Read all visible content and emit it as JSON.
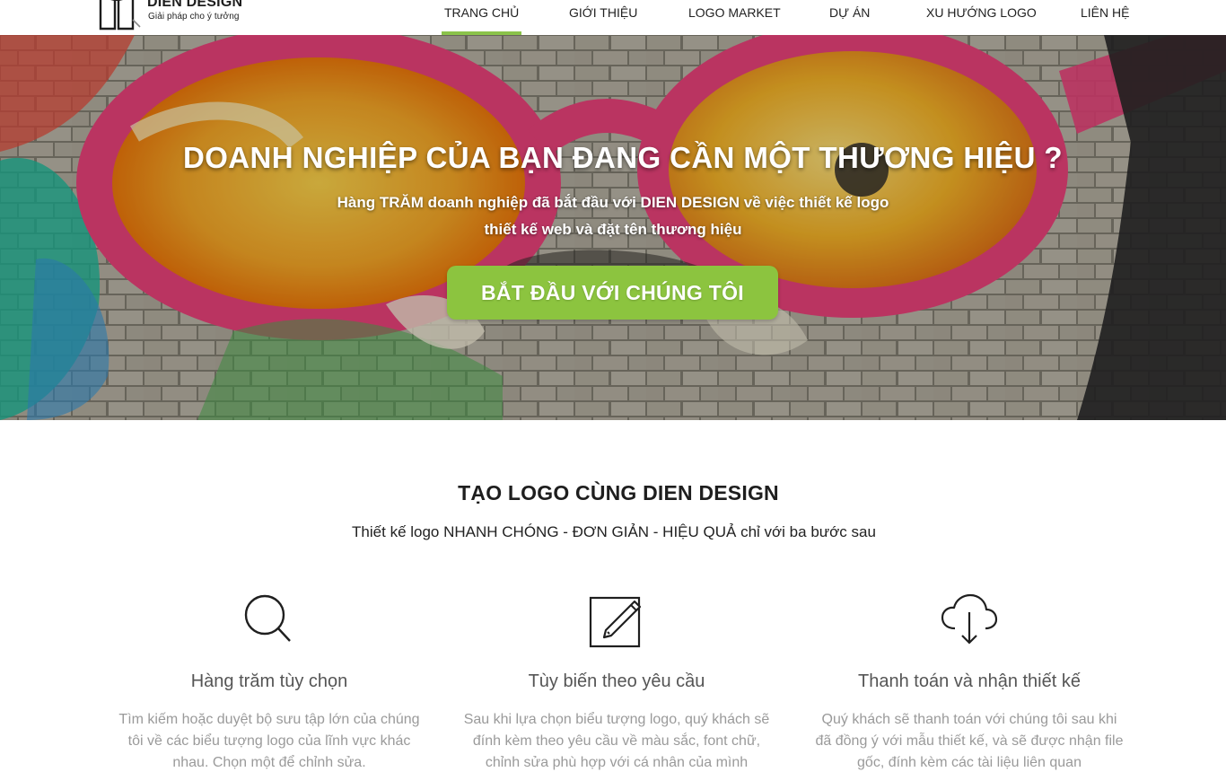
{
  "brand": {
    "name": "DIEN DESIGN",
    "tagline": "Giải pháp cho ý tưởng"
  },
  "nav": {
    "items": [
      {
        "label": "TRANG CHỦ",
        "active": true
      },
      {
        "label": "GIỚI THIỆU",
        "active": false
      },
      {
        "label": "LOGO MARKET",
        "active": false
      },
      {
        "label": "DỰ ÁN",
        "active": false
      },
      {
        "label": "XU HƯỚNG LOGO",
        "active": false
      },
      {
        "label": "LIÊN HỆ",
        "active": false
      }
    ]
  },
  "hero": {
    "title": "DOANH NGHIỆP CỦA BẠN ĐANG CẦN MỘT THƯƠNG HIỆU ?",
    "subtitle_line1": "Hàng TRĂM doanh nghiệp đã bắt đầu với DIEN DESIGN về việc thiết kế logo",
    "subtitle_line2": "thiết kế web và đặt tên thương hiệu",
    "cta_label": "BẮT ĐẦU VỚI CHÚNG TÔI"
  },
  "section": {
    "title": "TẠO LOGO CÙNG DIEN DESIGN",
    "subtitle": "Thiết kế logo NHANH CHÓNG - ĐƠN GIẢN - HIỆU QUẢ chỉ với ba bước sau"
  },
  "features": [
    {
      "icon": "search-icon",
      "title": "Hàng trăm tùy chọn",
      "desc_lines": [
        "Tìm kiếm hoặc duyệt bộ sưu tập lớn của chúng",
        "tôi về các biểu tượng logo của lĩnh vực khác",
        "nhau. Chọn một để chỉnh sửa."
      ]
    },
    {
      "icon": "edit-icon",
      "title": "Tùy biến theo yêu cầu",
      "desc_lines": [
        "Sau khi lựa chọn biểu tượng logo, quý khách sẽ",
        "đính kèm theo yêu cầu về màu sắc, font chữ,",
        "chỉnh sửa phù hợp với cá nhân của mình"
      ]
    },
    {
      "icon": "cloud-download-icon",
      "title": "Thanh toán và nhận thiết kế",
      "desc_lines": [
        "Quý khách sẽ thanh toán với chúng tôi sau khi",
        "đã đồng ý với mẫu thiết kế, và sẽ được nhận file",
        "gốc, đính kèm các tài liệu liên quan"
      ]
    }
  ],
  "colors": {
    "accent": "#8cc43f",
    "nav_active_underline": "#8bc34a",
    "feature_title": "#555555",
    "feature_desc": "#9a9a9a"
  }
}
